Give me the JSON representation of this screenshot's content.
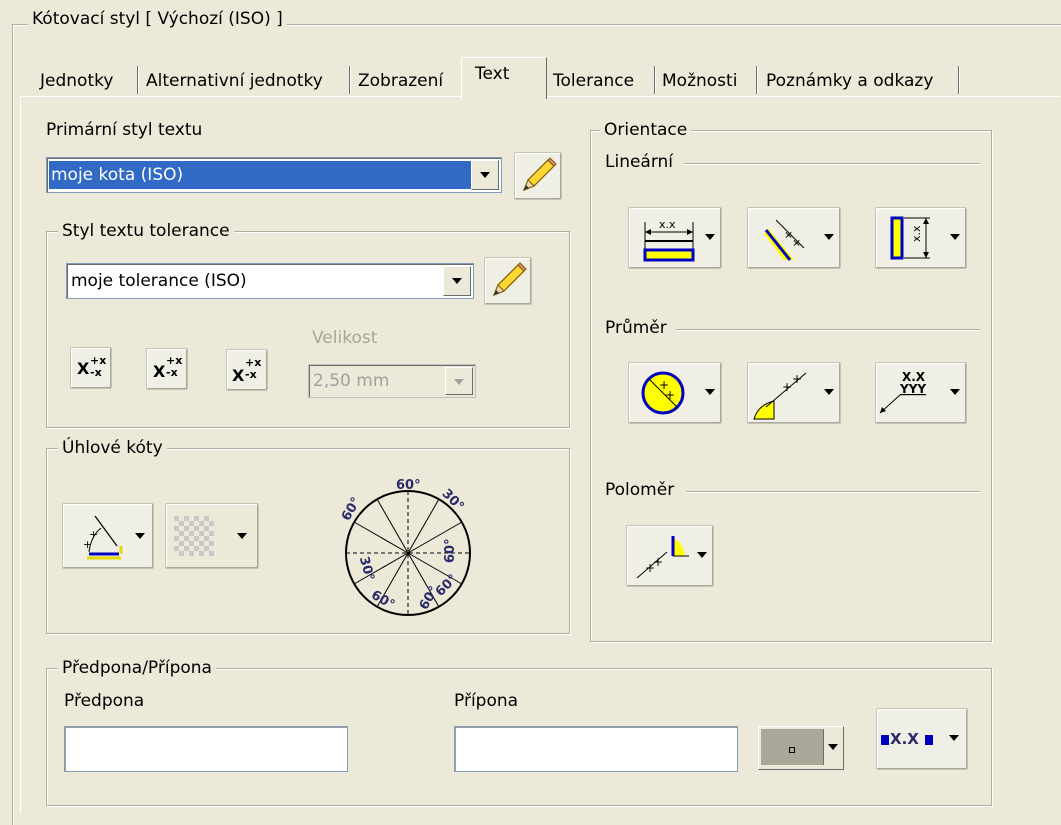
{
  "dialog": {
    "group_title": "Kótovací styl [ Výchozí (ISO) ]"
  },
  "tabs": [
    {
      "label": "Jednotky"
    },
    {
      "label": "Alternativní jednotky"
    },
    {
      "label": "Zobrazení"
    },
    {
      "label": "Text",
      "active": true
    },
    {
      "label": "Tolerance"
    },
    {
      "label": "Možnosti"
    },
    {
      "label": "Poznámky a odkazy"
    }
  ],
  "primary": {
    "label": "Primární styl textu",
    "value": "moje kota (ISO)",
    "edit_icon": "pencil-icon"
  },
  "tolerance": {
    "group_label": "Styl textu tolerance",
    "value": "moje tolerance (ISO)",
    "edit_icon": "pencil-icon",
    "size_label": "Velikost",
    "size_value": "2,50 mm",
    "tol_glyph": "X",
    "tol_plus": "+x",
    "tol_minus": "-x"
  },
  "angular": {
    "group_label": "Úhlové kóty",
    "diagram_labels": [
      "60°",
      "30°",
      "60°",
      "60°",
      "30°",
      "60°",
      "60°",
      "60°"
    ]
  },
  "orientation": {
    "group_label": "Orientace",
    "linear_label": "Lineární",
    "diameter_label": "Průměr",
    "radius_label": "Poloměr",
    "xx": "x.x",
    "xx2": "X.X",
    "yyy": "YYY"
  },
  "affix": {
    "group_label": "Předpona/Přípona",
    "prefix_label": "Předpona",
    "prefix_value": "",
    "suffix_label": "Přípona",
    "suffix_value": "",
    "format_text": "X.X"
  },
  "colors": {
    "accent_yellow": "#ffff00",
    "accent_blue": "#0000c0",
    "selection": "#316ac5"
  }
}
